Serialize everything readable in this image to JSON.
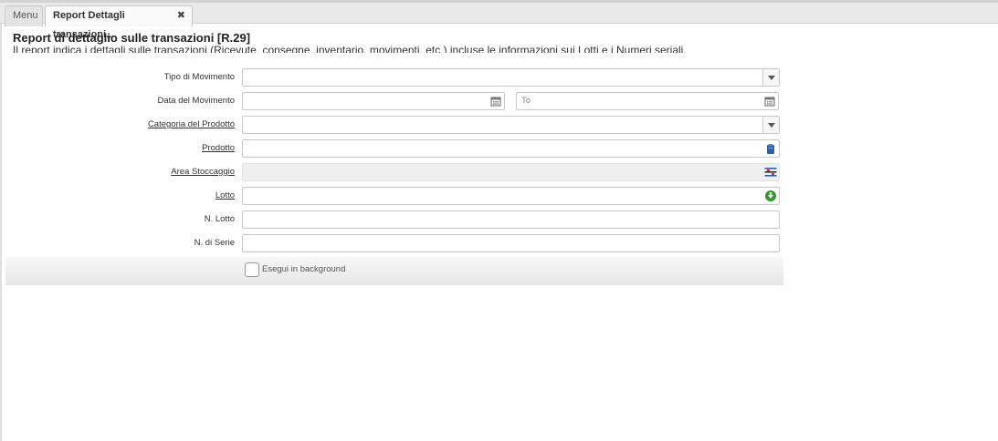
{
  "tabs": [
    {
      "label": "Menu"
    },
    {
      "label": "Report Dettagli transazioni...",
      "close": "✖"
    }
  ],
  "header": {
    "title": "Report di dettaglio sulle transazioni [R.29]",
    "description": "Il report indica i dettagli sulle transazioni (Ricevute, consegne, inventario, movimenti, etc.) incluse le informazioni sui Lotti e i Numeri seriali."
  },
  "form": {
    "tipo_movimento": {
      "label": "Tipo di Movimento",
      "value": "",
      "icon": "chevron-down-icon"
    },
    "data_movimento": {
      "label": "Data del Movimento",
      "from_value": "",
      "to_placeholder": "To",
      "icon": "calendar-icon"
    },
    "categoria_prodotto": {
      "label": "Categoria del Prodotto",
      "value": "",
      "icon": "chevron-down-icon"
    },
    "prodotto": {
      "label": "Prodotto",
      "value": "",
      "icon": "product-search-icon"
    },
    "area_stoccaggio": {
      "label": "Area Stoccaggio",
      "value": "",
      "icon": "locator-icon"
    },
    "lotto": {
      "label": "Lotto",
      "value": "",
      "icon": "lot-search-icon"
    },
    "n_lotto": {
      "label": "N. Lotto",
      "value": ""
    },
    "n_serie": {
      "label": "N. di Serie",
      "value": ""
    }
  },
  "footer": {
    "background_label": "Esegui in background",
    "background_checked": false
  },
  "colors": {
    "accent_green": "#2e9a2e",
    "accent_blue": "#2c5fa8"
  }
}
